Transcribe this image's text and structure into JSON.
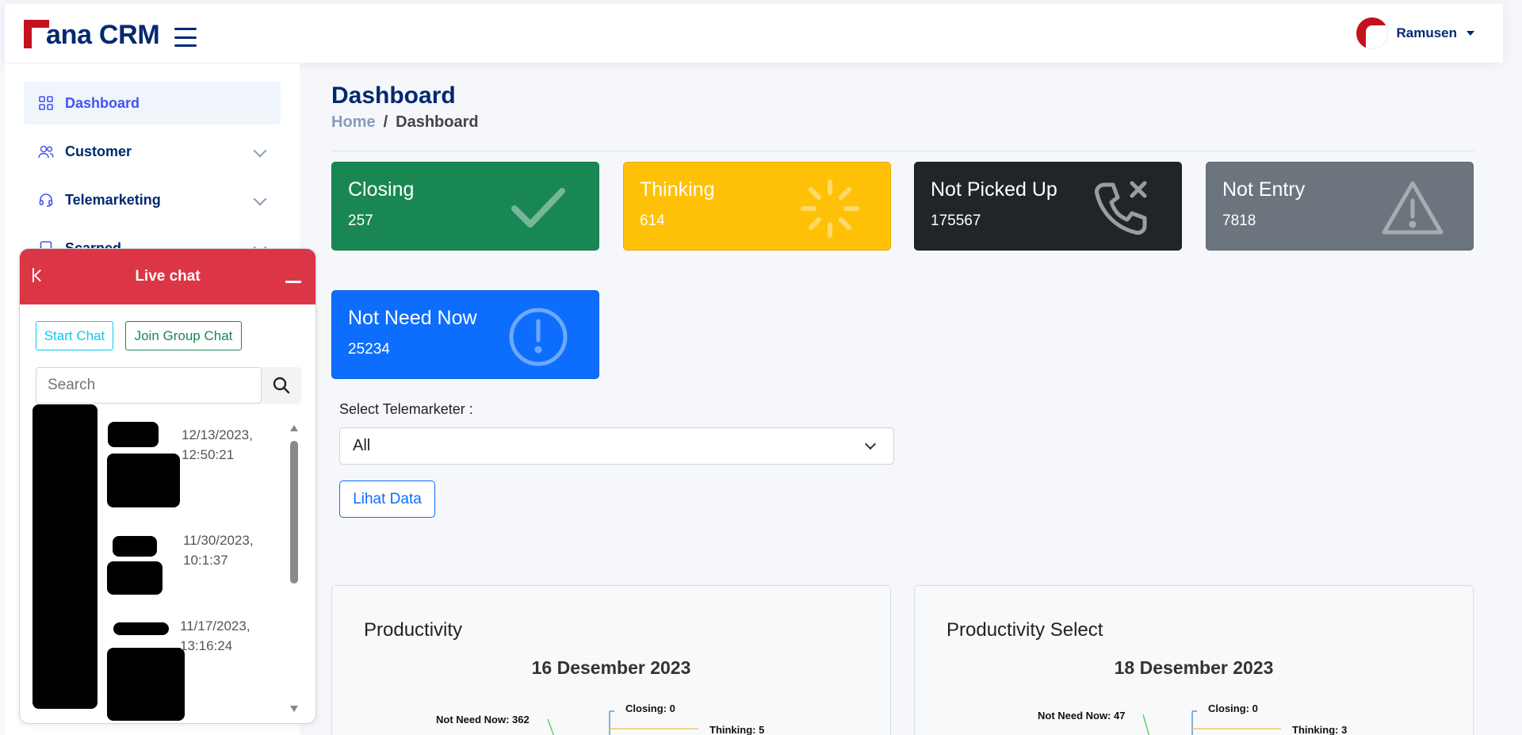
{
  "header": {
    "brand": "ana CRM",
    "user_name": "Ramusen"
  },
  "sidebar": {
    "items": [
      {
        "label": "Dashboard",
        "icon": "grid-icon"
      },
      {
        "label": "Customer",
        "icon": "people-icon"
      },
      {
        "label": "Telemarketing",
        "icon": "headset-icon"
      },
      {
        "label": "Scarned",
        "icon": "file-icon"
      }
    ]
  },
  "main": {
    "title": "Dashboard",
    "breadcrumb": {
      "home": "Home",
      "separator": "/",
      "current": "Dashboard"
    },
    "stats": [
      {
        "title": "Closing",
        "value": "257",
        "color": "#198754",
        "icon": "check-icon"
      },
      {
        "title": "Thinking",
        "value": "614",
        "color": "#ffc107",
        "icon": "spinner-icon"
      },
      {
        "title": "Not Picked Up",
        "value": "175567",
        "color": "#212529",
        "icon": "phone-missed-icon"
      },
      {
        "title": "Not Entry",
        "value": "7818",
        "color": "#6c757d",
        "icon": "warning-icon"
      },
      {
        "title": "Not Need Now",
        "value": "25234",
        "color": "#0d6efd",
        "icon": "exclamation-circle-icon"
      }
    ],
    "filter": {
      "label": "Select Telemarketer :",
      "selected": "All",
      "button": "Lihat Data"
    },
    "cards": [
      {
        "title": "Productivity",
        "date": "16 Desember 2023",
        "labels": [
          "Not Need Now: 362",
          "Closing: 0",
          "Thinking: 5"
        ]
      },
      {
        "title": "Productivity Select",
        "date": "18 Desember 2023",
        "labels": [
          "Not Need Now: 47",
          "Closing: 0",
          "Thinking: 3"
        ]
      }
    ]
  },
  "chat": {
    "title": "Live chat",
    "start_button": "Start Chat",
    "group_button": "Join Group Chat",
    "search_placeholder": "Search",
    "items": [
      {
        "time_line1": "12/13/2023,",
        "time_line2": "12:50:21"
      },
      {
        "time_line1": "11/30/2023,",
        "time_line2": "10:1:37"
      },
      {
        "time_line1": "11/17/2023,",
        "time_line2": "13:16:24"
      }
    ]
  }
}
